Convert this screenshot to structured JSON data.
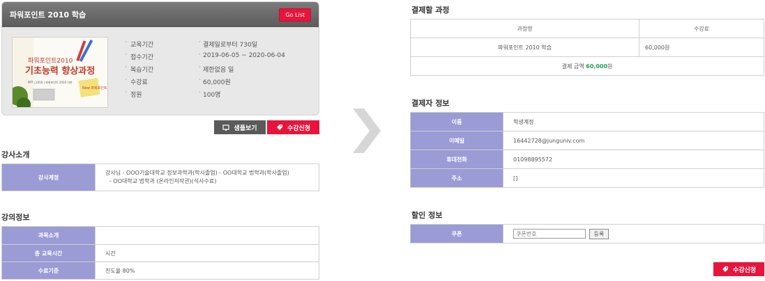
{
  "course": {
    "title": "파워포인트 2010 학습",
    "go_list": "Go List",
    "thumbnail": {
      "line1": "파워포인트2010",
      "line2": "기초능력 향상과정",
      "line3": "PPT | 2010 | 파워포인트 2010 기본",
      "memo": "New 파워포인트"
    },
    "info": [
      {
        "key": "교육기간",
        "value": "결제일로부터 730일"
      },
      {
        "key": "접수기간",
        "value": "2019-06-05 ~ 2020-06-04"
      },
      {
        "key": "복습기간",
        "value": "제한없음 일"
      },
      {
        "key": "수강료",
        "value": "60,000원"
      },
      {
        "key": "정원",
        "value": "100명"
      }
    ],
    "sample_button": "샘플보기",
    "apply_button": "수강신청"
  },
  "instructor": {
    "section_title": "강사소개",
    "label": "강사계정",
    "line1": "강사님 - OOO기술대학교 정보과학과(학사졸업) - OO대학교 법학과(학사졸업)",
    "line2": "- OO대학교 법학과 (온라인저작권)(석사수료)"
  },
  "lecture": {
    "section_title": "강의정보",
    "rows": [
      {
        "label": "과목소개",
        "value": ""
      },
      {
        "label": "총 교육시간",
        "value": "시간"
      },
      {
        "label": "수료기준",
        "value": "진도율 80%"
      }
    ]
  },
  "payment_course": {
    "section_title": "결제할 과정",
    "headers": [
      "과정명",
      "수강료"
    ],
    "row": {
      "name": "파워포인트 2010 학습",
      "fee": "60,000원"
    },
    "total_label": "결제 금액",
    "total_value": "60,000",
    "total_unit": "원"
  },
  "payer": {
    "section_title": "결제자 정보",
    "rows": [
      {
        "label": "이름",
        "value": "학생계정"
      },
      {
        "label": "이메일",
        "value": "16442728@junguniv.com"
      },
      {
        "label": "휴대전화",
        "value": "01098895572"
      },
      {
        "label": "주소",
        "value": "[]"
      }
    ]
  },
  "discount": {
    "section_title": "할인 정보",
    "coupon_label": "쿠폰",
    "coupon_placeholder": "쿠폰번호",
    "register_button": "등록"
  },
  "apply_button_bottom": "수강신청",
  "colors": {
    "accent": "#e8143c",
    "label_bg": "#9b9bd6",
    "header_gray": "#666666",
    "total_green": "#1e9e5a"
  }
}
